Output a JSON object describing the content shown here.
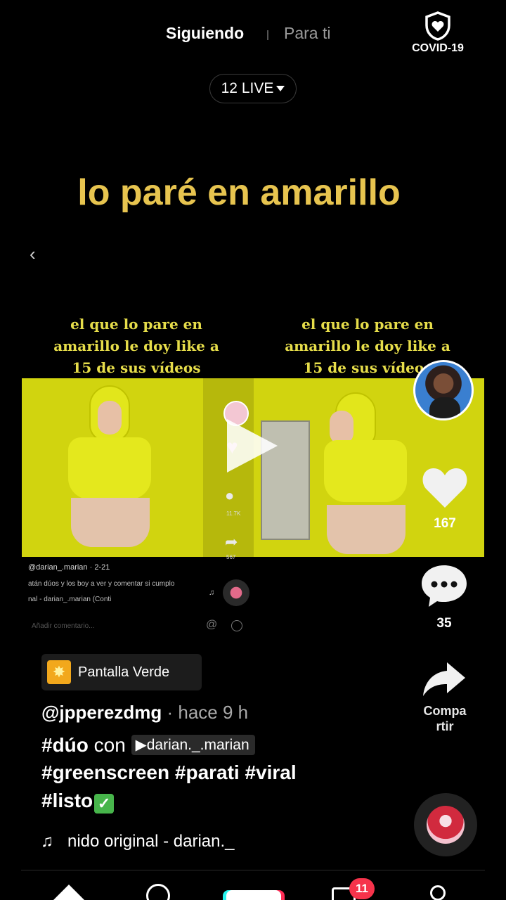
{
  "top_nav": {
    "following": "Siguiendo",
    "for_you": "Para ti",
    "covid_label": "COVID-19"
  },
  "live": {
    "label": "12 LIVE"
  },
  "caption": "lo paré en amarillo",
  "embedded_video": {
    "overlay_text_left": "el que lo pare en amarillo le doy like a 15 de sus vídeos",
    "overlay_text_right": "el que lo pare en amarillo le doy like a 15 de sus vídeos",
    "mid_comment_count": "11.7K",
    "mid_share_count": "567",
    "username": "@darian_.marian · 2-21",
    "description": "atán dúos y los boy a ver y comentar si cumplo",
    "sound": "nal - darian_.marian (Conti",
    "comment_placeholder": "Añadir comentario..."
  },
  "right_rail": {
    "likes": "167",
    "comments": "35",
    "share_label": "Compa\nrtir"
  },
  "effect": {
    "label": "Pantalla Verde"
  },
  "post": {
    "author": "@jpperezdmg",
    "time": " · hace 9 h",
    "duet_prefix": "#dúo",
    "duet_con": " con ",
    "duet_user": "darian._.marian",
    "hashtags_line2": "#greenscreen #parati #viral",
    "hashtags_line3": "#listo",
    "sound": "nido original - darian._"
  },
  "bottom_nav": {
    "inbox_badge": "11"
  },
  "colors": {
    "caption": "#e7c44f",
    "greenscreen": "#d1d40f",
    "badge": "#f6334b",
    "effect_icon": "#f2a81c"
  }
}
